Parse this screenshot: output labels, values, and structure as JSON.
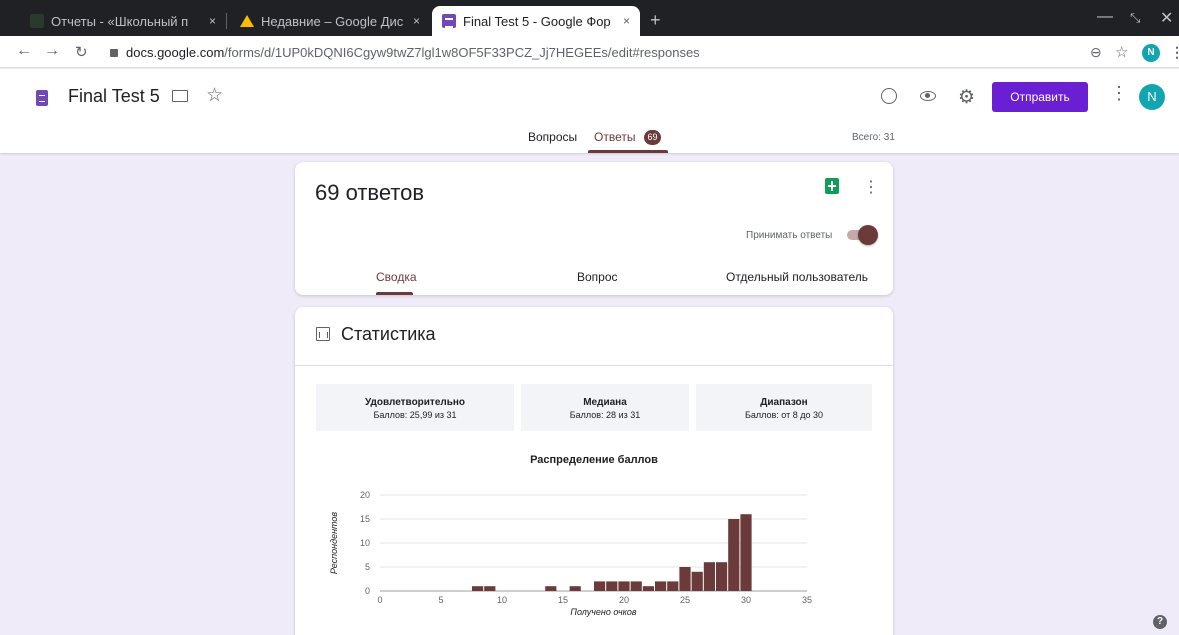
{
  "browser": {
    "tabs": [
      {
        "title": "Отчеты - «Школьный п",
        "close": "×"
      },
      {
        "title": "Недавние – Google Дис",
        "close": "×"
      },
      {
        "title": "Final Test 5 - Google Фор",
        "close": "×"
      }
    ],
    "new_tab": "+",
    "url_host": "docs.google.com",
    "url_path": "/forms/d/1UP0kDQNI6Cgyw9twZ7lgl1w8OF5F33PCZ_Jj7HEGEEs/edit#responses",
    "profile_initial": "N"
  },
  "header": {
    "form_title": "Final Test 5",
    "send_label": "Отправить",
    "avatar_initial": "N",
    "tabs": {
      "questions": "Вопросы",
      "responses": "Ответы"
    },
    "responses_badge": "69",
    "total": "Всего: 31"
  },
  "responses_card": {
    "count_title": "69 ответов",
    "accept_label": "Принимать ответы",
    "accepting": true,
    "tabs": [
      "Сводка",
      "Вопрос",
      "Отдельный пользователь"
    ]
  },
  "stats_card": {
    "title": "Статистика",
    "summaries": [
      {
        "label": "Удовлетворительно",
        "value": "Баллов: 25,99 из 31"
      },
      {
        "label": "Медиана",
        "value": "Баллов: 28 из 31"
      },
      {
        "label": "Диапазон",
        "value": "Баллов: от 8 до 30"
      }
    ]
  },
  "chart_data": {
    "type": "bar",
    "title": "Распределение баллов",
    "xlabel": "Получено очков",
    "ylabel": "Респондентов",
    "xlim": [
      0,
      35
    ],
    "ylim": [
      0,
      20
    ],
    "x_ticks": [
      0,
      5,
      10,
      15,
      20,
      25,
      30,
      35
    ],
    "y_ticks": [
      0,
      5,
      10,
      15,
      20
    ],
    "grid": true,
    "bar_color": "#6b3a3a",
    "x": [
      8,
      9,
      14,
      16,
      18,
      19,
      20,
      21,
      22,
      23,
      24,
      25,
      26,
      27,
      28,
      29,
      30
    ],
    "values": [
      1,
      1,
      1,
      1,
      2,
      2,
      2,
      2,
      1,
      2,
      2,
      5,
      4,
      6,
      6,
      15,
      16
    ]
  },
  "colors": {
    "accent": "#6b3a3a",
    "send_button": "#6a1fd4",
    "page_bg": "#f0ebf8"
  }
}
